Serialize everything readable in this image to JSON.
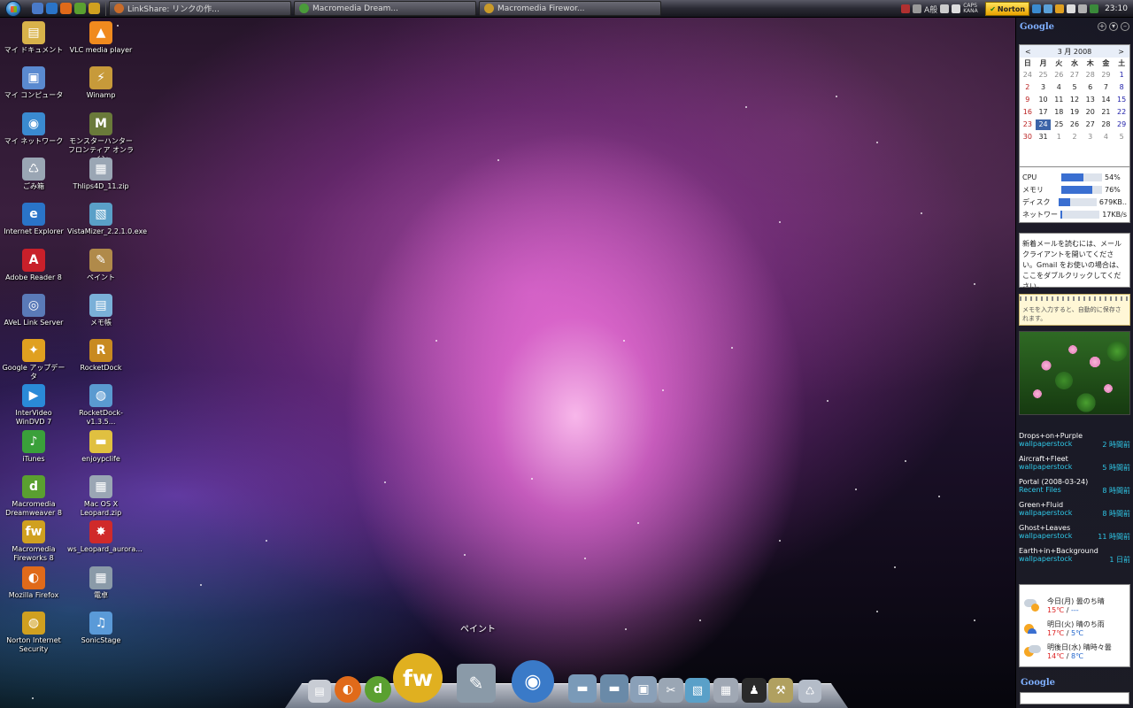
{
  "taskbar": {
    "tasks": [
      {
        "label": "LinkShare: リンクの作...",
        "color": "#c96c2a"
      },
      {
        "label": "Macromedia Dream...",
        "color": "#4a9a3a"
      },
      {
        "label": "Macromedia Firewor...",
        "color": "#c99a2a"
      }
    ],
    "tray_text_a": "A般",
    "tray_text_b": "CAPS KANA",
    "norton_label": "Norton",
    "clock": "23:10"
  },
  "desktop_icons": [
    {
      "label": "マイ ドキュメント",
      "glyph": "▤",
      "color": "#d8b24a"
    },
    {
      "label": "VLC media player",
      "glyph": "▲",
      "color": "#f08a1e"
    },
    {
      "label": "マイ コンピュータ",
      "glyph": "▣",
      "color": "#5a8ad0"
    },
    {
      "label": "Winamp",
      "glyph": "⚡",
      "color": "#c79a3a"
    },
    {
      "label": "マイ ネットワーク",
      "glyph": "◉",
      "color": "#3a8ad0"
    },
    {
      "label": "モンスターハンター フロンティア オンライン",
      "glyph": "M",
      "color": "#6a7a3a"
    },
    {
      "label": "ごみ箱",
      "glyph": "♺",
      "color": "#9aa6b4"
    },
    {
      "label": "Thlips4D_11.zip",
      "glyph": "▦",
      "color": "#9aa6b4"
    },
    {
      "label": "Internet Explorer",
      "glyph": "e",
      "color": "#2a74c8"
    },
    {
      "label": "VistaMizer_2.2.1.0.exe",
      "glyph": "▧",
      "color": "#5aa0c8"
    },
    {
      "label": "Adobe Reader 8",
      "glyph": "A",
      "color": "#c8202a"
    },
    {
      "label": "ペイント",
      "glyph": "✎",
      "color": "#b08a4a"
    },
    {
      "label": "AVeL Link Server",
      "glyph": "◎",
      "color": "#5a7ab8"
    },
    {
      "label": "メモ帳",
      "glyph": "▤",
      "color": "#7ab0d8"
    },
    {
      "label": "Google アップデータ",
      "glyph": "✦",
      "color": "#e0a020"
    },
    {
      "label": "RocketDock",
      "glyph": "R",
      "color": "#c88a20"
    },
    {
      "label": "InterVideo WinDVD 7",
      "glyph": "▶",
      "color": "#2a8ad8"
    },
    {
      "label": "RocketDock-v1.3.5...",
      "glyph": "◍",
      "color": "#5a9ad0"
    },
    {
      "label": "iTunes",
      "glyph": "♪",
      "color": "#3aa03a"
    },
    {
      "label": "enjoypclife",
      "glyph": "▬",
      "color": "#e0c040"
    },
    {
      "label": "Macromedia Dreamweaver 8",
      "glyph": "d",
      "color": "#5aa030"
    },
    {
      "label": "Mac OS X Leopard.zip",
      "glyph": "▦",
      "color": "#9aa6b4"
    },
    {
      "label": "Macromedia Fireworks 8",
      "glyph": "fw",
      "color": "#d0a020"
    },
    {
      "label": "ws_Leopard_aurora...",
      "glyph": "✸",
      "color": "#d02a2a"
    },
    {
      "label": "Mozilla Firefox",
      "glyph": "◐",
      "color": "#e06a1a"
    },
    {
      "label": "電卓",
      "glyph": "▦",
      "color": "#8a9aa8"
    },
    {
      "label": "Norton Internet Security",
      "glyph": "◍",
      "color": "#d0a020"
    },
    {
      "label": "SonicStage",
      "glyph": "♫",
      "color": "#5a9ad8"
    }
  ],
  "dock": {
    "hover_label": "ペイント",
    "items": [
      {
        "name": "dock-item-document-icon",
        "glyph": "▤",
        "color": "#c8ccd4"
      },
      {
        "name": "dock-item-firefox-icon",
        "glyph": "◐",
        "color": "#e06a1a"
      },
      {
        "name": "dock-item-dreamweaver-icon",
        "glyph": "d",
        "color": "#5aa030"
      },
      {
        "name": "dock-item-fireworks-icon",
        "glyph": "fw",
        "color": "#e0b020"
      },
      {
        "name": "dock-item-paint-icon",
        "glyph": "✎",
        "color": "#8a9aa8"
      },
      {
        "name": "dock-item-globe-icon",
        "glyph": "◉",
        "color": "#3a7ac8"
      },
      {
        "name": "dock-item-folder-icon",
        "glyph": "▬",
        "color": "#7a9ab8"
      },
      {
        "name": "dock-item-folder-icon",
        "glyph": "▬",
        "color": "#6a8aa8"
      },
      {
        "name": "dock-item-images-icon",
        "glyph": "▣",
        "color": "#8aa0b8"
      },
      {
        "name": "dock-item-tools-icon",
        "glyph": "✂",
        "color": "#9aa6b4"
      },
      {
        "name": "dock-item-notepad-icon",
        "glyph": "▧",
        "color": "#5aa0c8"
      },
      {
        "name": "dock-item-calculator-icon",
        "glyph": "▦",
        "color": "#a0a8b4"
      },
      {
        "name": "dock-item-tuxedo-icon",
        "glyph": "♟",
        "color": "#2a2a2a"
      },
      {
        "name": "dock-item-utilities-icon",
        "glyph": "⚒",
        "color": "#b0a060"
      },
      {
        "name": "dock-item-trash-icon",
        "glyph": "♺",
        "color": "#b4bcc8"
      }
    ]
  },
  "sidebar": {
    "logo": "Google",
    "calendar": {
      "prev": "<",
      "next": ">",
      "month_title": "3 月 2008",
      "weekdays": [
        "日",
        "月",
        "火",
        "水",
        "木",
        "金",
        "土"
      ],
      "days": [
        "24",
        "25",
        "26",
        "27",
        "28",
        "29",
        "1",
        "2",
        "3",
        "4",
        "5",
        "6",
        "7",
        "8",
        "9",
        "10",
        "11",
        "12",
        "13",
        "14",
        "15",
        "16",
        "17",
        "18",
        "19",
        "20",
        "21",
        "22",
        "23",
        "24",
        "25",
        "26",
        "27",
        "28",
        "29",
        "30",
        "31",
        "1",
        "2",
        "3",
        "4",
        "5"
      ],
      "today_index": 29
    },
    "sysmon": [
      {
        "label": "CPU",
        "value": "54%",
        "level": 0.54
      },
      {
        "label": "メモリ",
        "value": "76%",
        "level": 0.76
      },
      {
        "label": "ディスク",
        "value": "679KB..",
        "level": 0.3
      },
      {
        "label": "ネットワー",
        "value": "17KB/s",
        "level": 0.05
      }
    ],
    "gmail_text": "新着メールを読むには、メールクライアントを開いてください。Gmail をお使いの場合は、ここをダブルクリックしてください。",
    "memo_placeholder": "メモを入力すると、自動的に保存されます。",
    "feeds": [
      {
        "title": "Drops+on+Purple",
        "source": "wallpaperstock",
        "time": "2 時間前"
      },
      {
        "title": "Aircraft+Fleet",
        "source": "wallpaperstock",
        "time": "5 時間前"
      },
      {
        "title": "Portal (2008-03-24)",
        "source": "Recent Files",
        "time": "8 時間前"
      },
      {
        "title": "Green+Fluid",
        "source": "wallpaperstock",
        "time": "8 時間前"
      },
      {
        "title": "Ghost+Leaves",
        "source": "wallpaperstock",
        "time": "11 時間前"
      },
      {
        "title": "Earth+in+Background",
        "source": "wallpaperstock",
        "time": "1 日前"
      }
    ],
    "weather": [
      {
        "day": "今日(月) 曇のち晴",
        "hi": "15℃",
        "lo": "---",
        "icon": "cloud-sun"
      },
      {
        "day": "明日(火) 晴のち雨",
        "hi": "17℃",
        "lo": "5℃",
        "icon": "sun-rain"
      },
      {
        "day": "明後日(水) 晴時々曇",
        "hi": "14℃",
        "lo": "8℃",
        "icon": "sun-cloud"
      }
    ],
    "search_logo": "Google"
  }
}
